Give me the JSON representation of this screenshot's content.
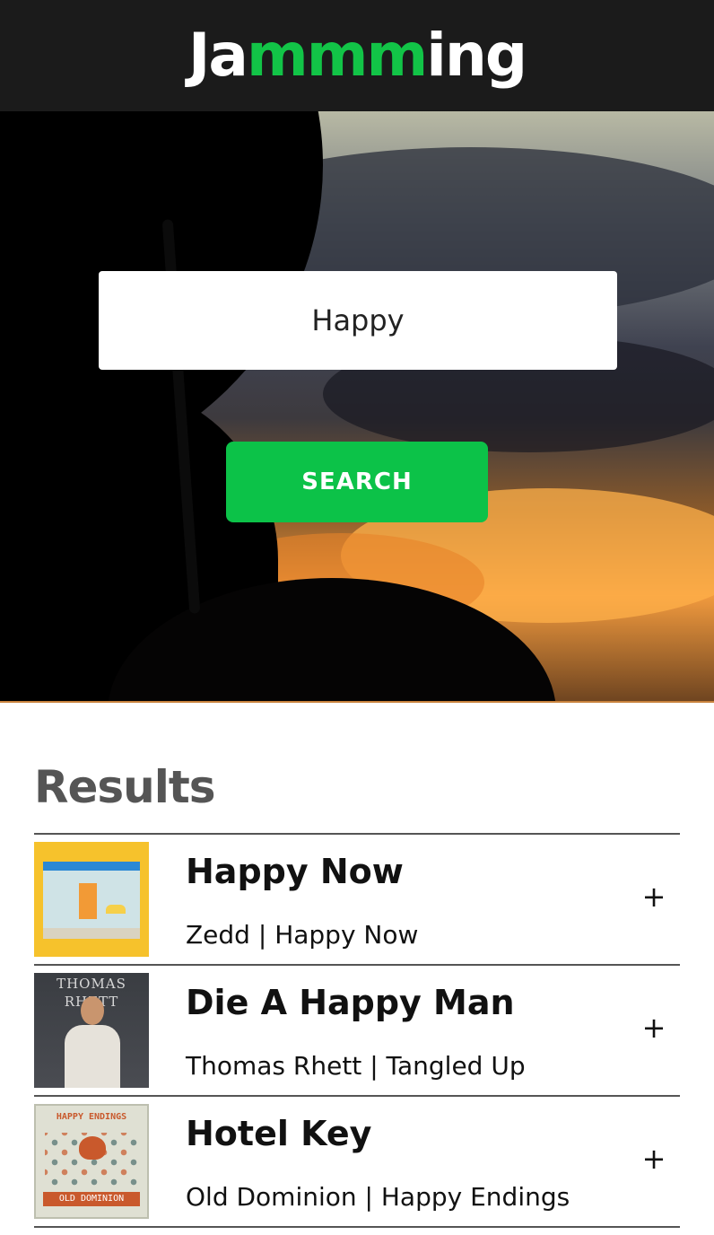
{
  "app": {
    "title_prefix": "Ja",
    "title_accent": "mmm",
    "title_suffix": "ing"
  },
  "search": {
    "value": "Happy",
    "button_label": "SEARCH"
  },
  "results": {
    "heading": "Results",
    "tracks": [
      {
        "name": "Happy Now",
        "artist": "Zedd",
        "album": "Happy Now",
        "meta": "Zedd | Happy Now",
        "action": "+"
      },
      {
        "name": "Die A Happy Man",
        "artist": "Thomas Rhett",
        "album": "Tangled Up",
        "meta": "Thomas Rhett | Tangled Up",
        "action": "+"
      },
      {
        "name": "Hotel Key",
        "artist": "Old Dominion",
        "album": "Happy Endings",
        "meta": "Old Dominion | Happy Endings",
        "action": "+"
      }
    ]
  },
  "album_art_text": {
    "rhett_banner": "THOMAS RHETT",
    "od_top": "HAPPY ENDINGS",
    "od_bottom": "OLD DOMINION"
  },
  "colors": {
    "accent": "#12c447",
    "button": "#0cc248",
    "header_bg": "#1b1b1b",
    "results_heading": "#555555"
  }
}
